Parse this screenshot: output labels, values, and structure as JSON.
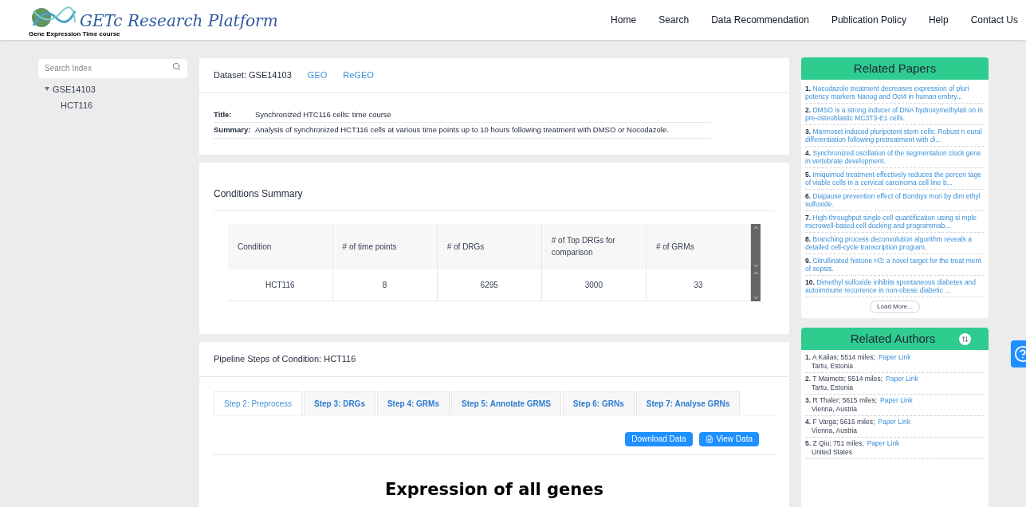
{
  "logo": {
    "title": "GETc Research Platform",
    "subtitle": "Gene Expression Time course"
  },
  "nav": [
    "Home",
    "Search",
    "Data Recommendation",
    "Publication Policy",
    "Help",
    "Contact Us"
  ],
  "sidebar": {
    "search": {
      "placeholder": "Search Index"
    },
    "tree": [
      {
        "label": "GSE14103",
        "expanded": true,
        "children": [
          {
            "label": "HCT116"
          }
        ]
      }
    ]
  },
  "dataset": {
    "label": "Dataset: GSE14103",
    "links": [
      "GEO",
      "ReGEO"
    ],
    "title_label": "Title:",
    "title": "Synchronized HTC116 cells: time course",
    "summary_label": "Summary:",
    "summary": "Analysis of synchronized HCT116 cells at various time points up to 10 hours following treatment with DMSO or Nocodazole."
  },
  "conditions": {
    "heading": "Conditions Summary",
    "columns": [
      "Condition",
      "# of time points",
      "# of DRGs",
      "# of Top DRGs for comparison",
      "# of GRMs"
    ],
    "rows": [
      [
        "HCT116",
        "8",
        "6295",
        "3000",
        "33"
      ]
    ]
  },
  "pipeline": {
    "heading": "Pipeline Steps of Condition: HCT116",
    "tabs": [
      {
        "label": "Step 2: Preprocess",
        "selected": true
      },
      {
        "label": "Step 3: DRGs",
        "selected": false
      },
      {
        "label": "Step 4: GRMs",
        "selected": false
      },
      {
        "label": "Step 5: Annotate GRMS",
        "selected": false
      },
      {
        "label": "Step 6: GRNs",
        "selected": false
      },
      {
        "label": "Step 7: Analyse GRNs",
        "selected": false
      }
    ],
    "buttons": [
      "Download Data",
      "View Data"
    ],
    "figure_title": "Expression of all genes"
  },
  "related_papers": {
    "heading": "Related Papers",
    "items": [
      {
        "num": "1.",
        "title": "Nocodazole treatment decreases expression of pluri potency markers Nanog and Oct4 in human embry..."
      },
      {
        "num": "2.",
        "title": "DMSO is a strong inducer of DNA hydroxymethylati on in pre-osteoblastic MC3T3-E1 cells."
      },
      {
        "num": "3.",
        "title": "Marmoset induced pluripotent stem cells: Robust n eural differentiation following pretreatment with di..."
      },
      {
        "num": "4.",
        "title": "Synchronized oscillation of the segmentation clock gene in vertebrate development."
      },
      {
        "num": "5.",
        "title": "Imiquimod treatment effectively reduces the percen tage of viable cells in a cervical carcinoma cell line b..."
      },
      {
        "num": "6.",
        "title": "Diapause prevention effect of Bombyx mori by dim ethyl sulfoxide."
      },
      {
        "num": "7.",
        "title": "High-throughput single-cell quantification using si mple microwell-based cell docking and programmab..."
      },
      {
        "num": "8.",
        "title": "Branching process deconvolution algorithm reveals a detailed cell-cycle transcription program."
      },
      {
        "num": "9.",
        "title": "Citrullinated histone H3: a novel target for the treat ment of sepsis."
      },
      {
        "num": "10.",
        "title": "Dimethyl sulfoxide inhibits spontaneous diabetes and autoimmune recurrence in non-obese diabetic ..."
      }
    ],
    "load_more": "Load More..."
  },
  "related_authors": {
    "heading": "Related Authors",
    "items": [
      {
        "num": "1.",
        "name": "A Kalias; 5514 miles;",
        "link": "Paper Link",
        "location": "Tartu, Estonia"
      },
      {
        "num": "2.",
        "name": "T Maimets; 5514 miles;",
        "link": "Paper Link",
        "location": "Tartu, Estonia"
      },
      {
        "num": "3.",
        "name": "R Thaler; 5615 miles;",
        "link": "Paper Link",
        "location": "Vienna, Austria"
      },
      {
        "num": "4.",
        "name": "F Varga; 5615 miles;",
        "link": "Paper Link",
        "location": "Vienna, Austria"
      },
      {
        "num": "5.",
        "name": "Z Qiu; 751 miles;",
        "link": "Paper Link",
        "location": "United States"
      }
    ]
  }
}
